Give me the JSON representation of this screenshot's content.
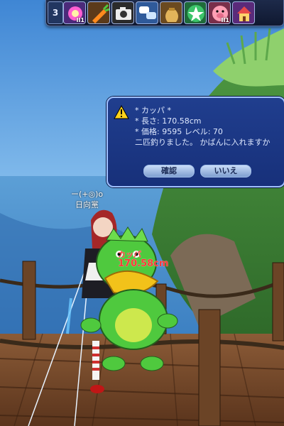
{
  "hotbar": {
    "page_number": "3",
    "slots": [
      {
        "icon": "magic-orb-icon",
        "badge": "II1"
      },
      {
        "icon": "carrot-icon",
        "badge": ""
      },
      {
        "icon": "camera-icon",
        "badge": ""
      },
      {
        "icon": "chat-bubbles-icon",
        "badge": ""
      },
      {
        "icon": "money-bag-icon",
        "badge": ""
      },
      {
        "icon": "star-icon",
        "badge": ""
      },
      {
        "icon": "pig-face-icon",
        "badge": "II1"
      },
      {
        "icon": "house-icon",
        "badge": ""
      }
    ]
  },
  "dialog": {
    "message": "* カッパ *\n* 長さ: 170.58cm\n* 価格: 9595 レベル: 70\n二匹釣りました。 かばんに入れますか",
    "confirm_label": "確認",
    "cancel_label": "いいえ"
  },
  "player": {
    "name": "日向黨",
    "guild_mark": "ー(+◎)o"
  },
  "catch": {
    "name": "カッパ",
    "size": "170.58cm"
  },
  "colors": {
    "dialog_bg": "#17307a",
    "dialog_border": "#9fc0ff",
    "catch_label": "#ff3a3a"
  }
}
